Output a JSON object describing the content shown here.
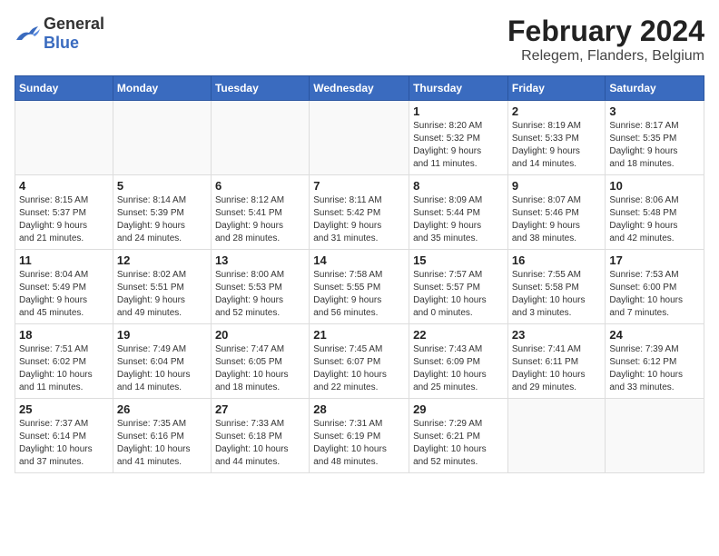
{
  "logo": {
    "general": "General",
    "blue": "Blue"
  },
  "title": "February 2024",
  "location": "Relegem, Flanders, Belgium",
  "weekdays": [
    "Sunday",
    "Monday",
    "Tuesday",
    "Wednesday",
    "Thursday",
    "Friday",
    "Saturday"
  ],
  "weeks": [
    [
      {
        "day": "",
        "info": ""
      },
      {
        "day": "",
        "info": ""
      },
      {
        "day": "",
        "info": ""
      },
      {
        "day": "",
        "info": ""
      },
      {
        "day": "1",
        "info": "Sunrise: 8:20 AM\nSunset: 5:32 PM\nDaylight: 9 hours\nand 11 minutes."
      },
      {
        "day": "2",
        "info": "Sunrise: 8:19 AM\nSunset: 5:33 PM\nDaylight: 9 hours\nand 14 minutes."
      },
      {
        "day": "3",
        "info": "Sunrise: 8:17 AM\nSunset: 5:35 PM\nDaylight: 9 hours\nand 18 minutes."
      }
    ],
    [
      {
        "day": "4",
        "info": "Sunrise: 8:15 AM\nSunset: 5:37 PM\nDaylight: 9 hours\nand 21 minutes."
      },
      {
        "day": "5",
        "info": "Sunrise: 8:14 AM\nSunset: 5:39 PM\nDaylight: 9 hours\nand 24 minutes."
      },
      {
        "day": "6",
        "info": "Sunrise: 8:12 AM\nSunset: 5:41 PM\nDaylight: 9 hours\nand 28 minutes."
      },
      {
        "day": "7",
        "info": "Sunrise: 8:11 AM\nSunset: 5:42 PM\nDaylight: 9 hours\nand 31 minutes."
      },
      {
        "day": "8",
        "info": "Sunrise: 8:09 AM\nSunset: 5:44 PM\nDaylight: 9 hours\nand 35 minutes."
      },
      {
        "day": "9",
        "info": "Sunrise: 8:07 AM\nSunset: 5:46 PM\nDaylight: 9 hours\nand 38 minutes."
      },
      {
        "day": "10",
        "info": "Sunrise: 8:06 AM\nSunset: 5:48 PM\nDaylight: 9 hours\nand 42 minutes."
      }
    ],
    [
      {
        "day": "11",
        "info": "Sunrise: 8:04 AM\nSunset: 5:49 PM\nDaylight: 9 hours\nand 45 minutes."
      },
      {
        "day": "12",
        "info": "Sunrise: 8:02 AM\nSunset: 5:51 PM\nDaylight: 9 hours\nand 49 minutes."
      },
      {
        "day": "13",
        "info": "Sunrise: 8:00 AM\nSunset: 5:53 PM\nDaylight: 9 hours\nand 52 minutes."
      },
      {
        "day": "14",
        "info": "Sunrise: 7:58 AM\nSunset: 5:55 PM\nDaylight: 9 hours\nand 56 minutes."
      },
      {
        "day": "15",
        "info": "Sunrise: 7:57 AM\nSunset: 5:57 PM\nDaylight: 10 hours\nand 0 minutes."
      },
      {
        "day": "16",
        "info": "Sunrise: 7:55 AM\nSunset: 5:58 PM\nDaylight: 10 hours\nand 3 minutes."
      },
      {
        "day": "17",
        "info": "Sunrise: 7:53 AM\nSunset: 6:00 PM\nDaylight: 10 hours\nand 7 minutes."
      }
    ],
    [
      {
        "day": "18",
        "info": "Sunrise: 7:51 AM\nSunset: 6:02 PM\nDaylight: 10 hours\nand 11 minutes."
      },
      {
        "day": "19",
        "info": "Sunrise: 7:49 AM\nSunset: 6:04 PM\nDaylight: 10 hours\nand 14 minutes."
      },
      {
        "day": "20",
        "info": "Sunrise: 7:47 AM\nSunset: 6:05 PM\nDaylight: 10 hours\nand 18 minutes."
      },
      {
        "day": "21",
        "info": "Sunrise: 7:45 AM\nSunset: 6:07 PM\nDaylight: 10 hours\nand 22 minutes."
      },
      {
        "day": "22",
        "info": "Sunrise: 7:43 AM\nSunset: 6:09 PM\nDaylight: 10 hours\nand 25 minutes."
      },
      {
        "day": "23",
        "info": "Sunrise: 7:41 AM\nSunset: 6:11 PM\nDaylight: 10 hours\nand 29 minutes."
      },
      {
        "day": "24",
        "info": "Sunrise: 7:39 AM\nSunset: 6:12 PM\nDaylight: 10 hours\nand 33 minutes."
      }
    ],
    [
      {
        "day": "25",
        "info": "Sunrise: 7:37 AM\nSunset: 6:14 PM\nDaylight: 10 hours\nand 37 minutes."
      },
      {
        "day": "26",
        "info": "Sunrise: 7:35 AM\nSunset: 6:16 PM\nDaylight: 10 hours\nand 41 minutes."
      },
      {
        "day": "27",
        "info": "Sunrise: 7:33 AM\nSunset: 6:18 PM\nDaylight: 10 hours\nand 44 minutes."
      },
      {
        "day": "28",
        "info": "Sunrise: 7:31 AM\nSunset: 6:19 PM\nDaylight: 10 hours\nand 48 minutes."
      },
      {
        "day": "29",
        "info": "Sunrise: 7:29 AM\nSunset: 6:21 PM\nDaylight: 10 hours\nand 52 minutes."
      },
      {
        "day": "",
        "info": ""
      },
      {
        "day": "",
        "info": ""
      }
    ]
  ]
}
